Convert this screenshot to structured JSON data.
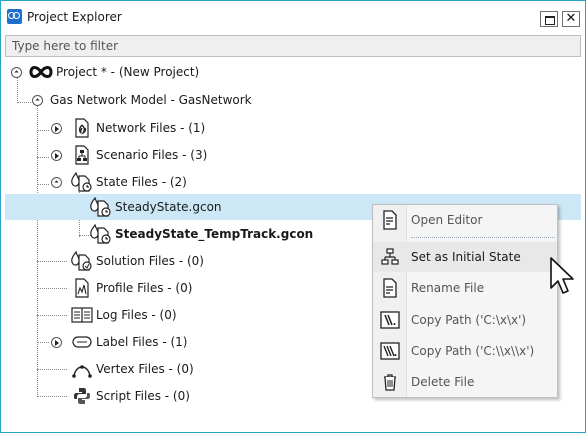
{
  "window": {
    "title": "Project Explorer",
    "close_glyph": "✕"
  },
  "filter": {
    "placeholder": "Type here to filter",
    "value": ""
  },
  "tree": {
    "project": {
      "label": "Project * - (New Project)",
      "icon": "infinity-icon"
    },
    "model": {
      "label": "Gas Network Model - GasNetwork"
    },
    "folders": [
      {
        "label": "Network Files - (1)",
        "icon": "network-file-icon",
        "expanded": false
      },
      {
        "label": "Scenario Files - (3)",
        "icon": "scenario-file-icon",
        "expanded": false
      },
      {
        "label": "State Files - (2)",
        "icon": "state-file-icon",
        "expanded": true
      },
      {
        "label": "Solution Files - (0)",
        "icon": "solution-file-icon"
      },
      {
        "label": "Profile Files - (0)",
        "icon": "profile-file-icon"
      },
      {
        "label": "Log Files - (0)",
        "icon": "log-file-icon"
      },
      {
        "label": "Label Files - (1)",
        "icon": "label-file-icon",
        "expanded": false
      },
      {
        "label": "Vertex Files - (0)",
        "icon": "vertex-file-icon"
      },
      {
        "label": "Script Files - (0)",
        "icon": "script-file-icon"
      }
    ],
    "state_files": [
      {
        "label": "SteadyState.gcon",
        "selected": true
      },
      {
        "label": "SteadyState_TempTrack.gcon",
        "bold": true
      }
    ]
  },
  "context_menu": {
    "items": [
      {
        "label": "Open Editor",
        "icon": "document-edit-icon"
      },
      {
        "label": "Set as Initial State",
        "icon": "hierarchy-icon",
        "hover": true
      },
      {
        "label": "Rename File",
        "icon": "rename-icon"
      },
      {
        "label": "Copy Path ('C:\\x\\x')",
        "icon": "path-icon"
      },
      {
        "label": "Copy Path ('C:\\\\x\\\\x')",
        "icon": "double-path-icon"
      },
      {
        "label": "Delete File",
        "icon": "trash-icon"
      }
    ]
  },
  "colors": {
    "accent": "#2aa3c9",
    "selection": "#cce8f7",
    "flame": "#d9481a"
  }
}
